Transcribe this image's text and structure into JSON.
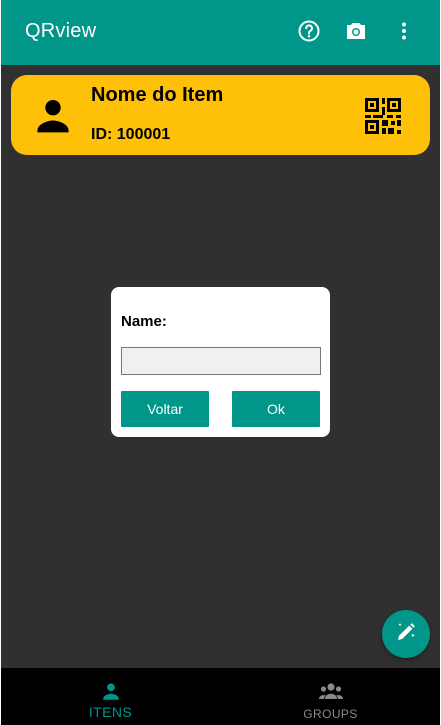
{
  "app": {
    "title": "QRview",
    "actions": [
      {
        "icon": "help-icon"
      },
      {
        "icon": "camera-icon"
      },
      {
        "icon": "more-vert-icon"
      }
    ],
    "colors": {
      "primary": "#00968a",
      "card": "#ffc107",
      "background": "#303030",
      "nav": "#000000"
    }
  },
  "item_card": {
    "name": "Nome do Item",
    "id_text": "ID: 100001",
    "avatar_icon": "person-icon",
    "qr_icon": "qr-code-icon"
  },
  "dialog": {
    "label": "Name:",
    "input_value": "",
    "input_placeholder": "",
    "back_label": "Voltar",
    "ok_label": "Ok"
  },
  "fab": {
    "icon": "edit-icon"
  },
  "bottom_nav": {
    "items": [
      {
        "label": "ITENS",
        "icon": "person-icon",
        "active": true
      },
      {
        "label": "GROUPS",
        "icon": "groups-icon",
        "active": false
      }
    ]
  }
}
